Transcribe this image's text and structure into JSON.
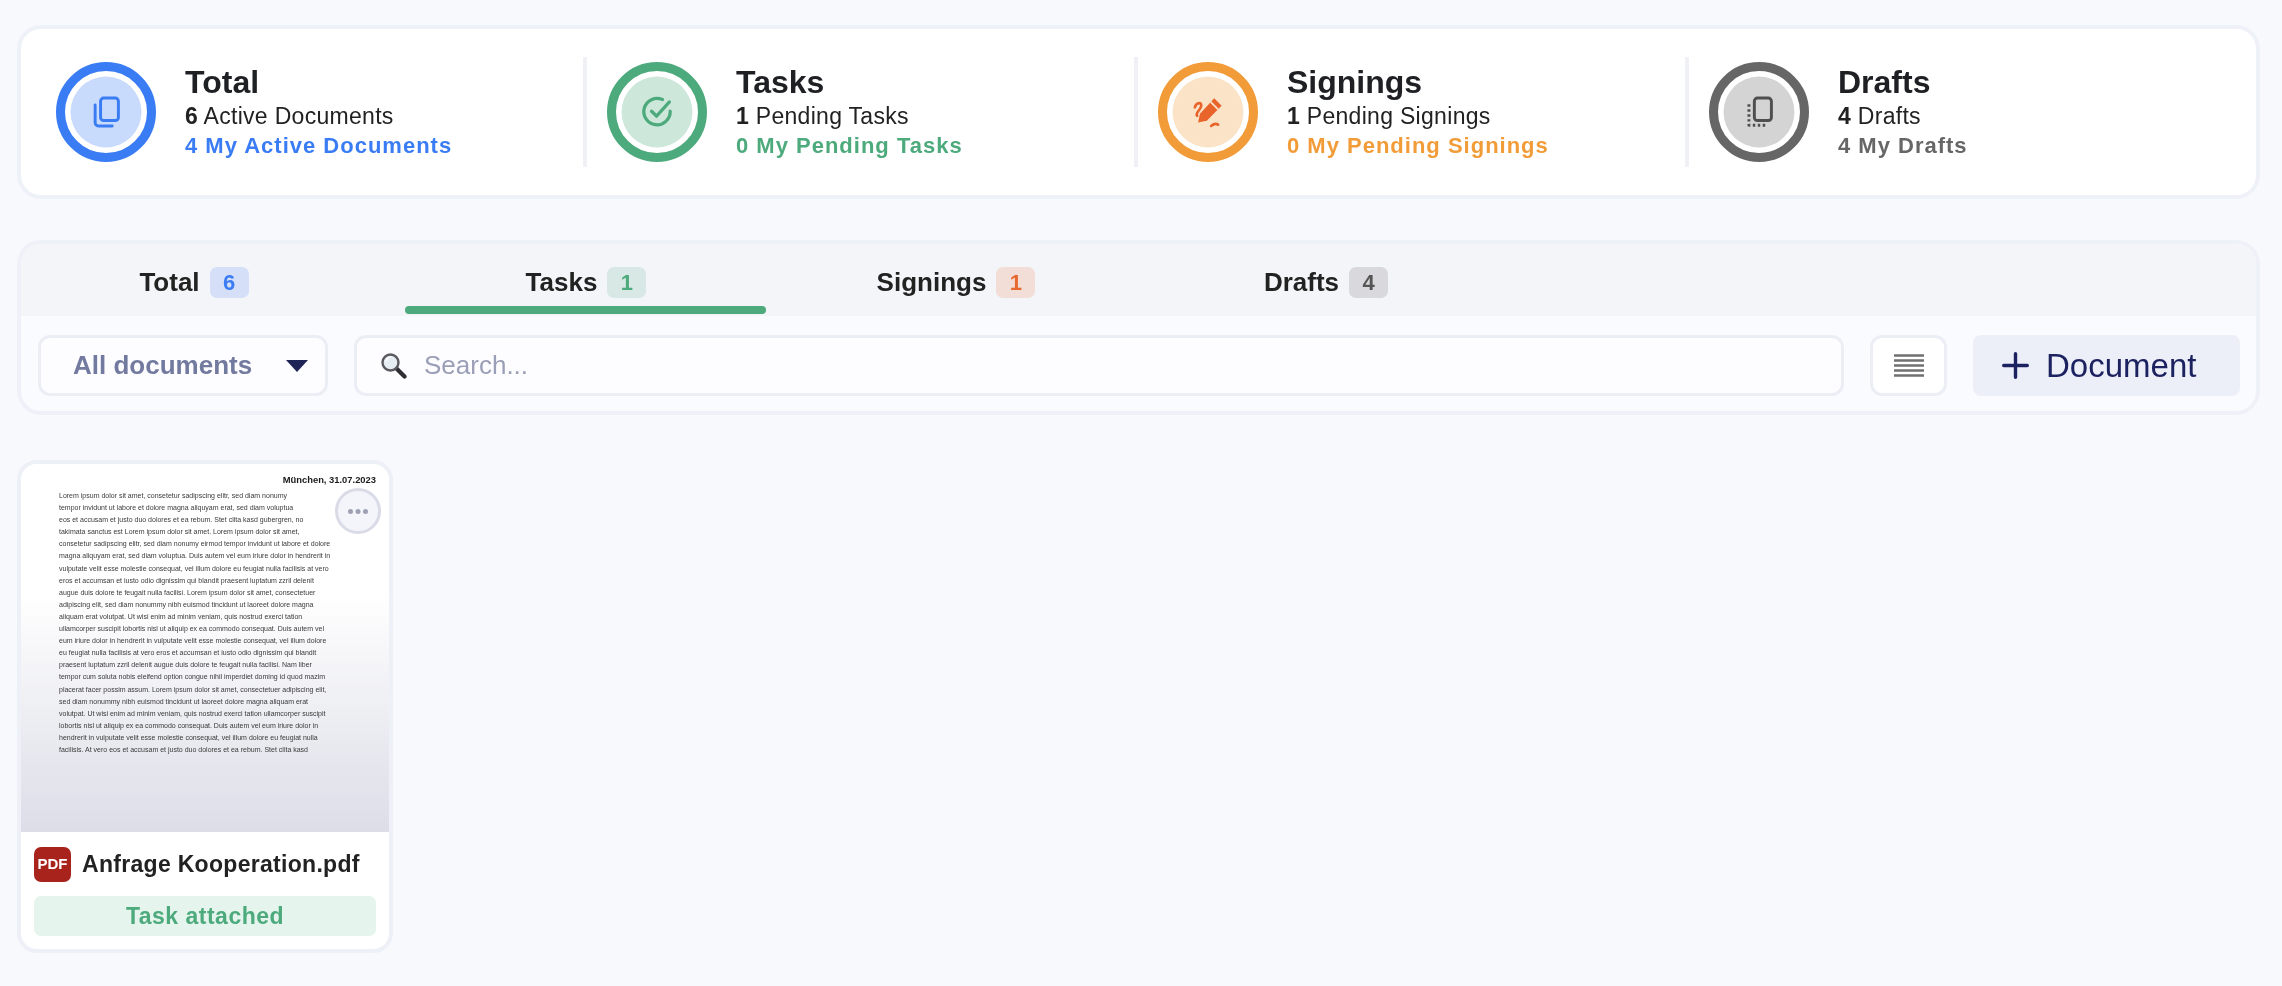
{
  "summary": [
    {
      "kind": "total",
      "title": "Total",
      "detail": "**6** Active Documents",
      "mine": "4 My Active Documents",
      "color": "#3a7cf4"
    },
    {
      "kind": "tasks",
      "title": "Tasks",
      "detail": "**1** Pending Tasks",
      "mine": "0 My Pending Tasks",
      "color": "#4daa7c"
    },
    {
      "kind": "signings",
      "title": "Signings",
      "detail": "**1** Pending Signings",
      "mine": "0 My Pending Signings",
      "color": "#f29c39"
    },
    {
      "kind": "drafts",
      "title": "Drafts",
      "detail": "**4** Drafts",
      "mine": "4 My Drafts",
      "color": "#666666"
    }
  ],
  "tabs": [
    {
      "label": "Total",
      "count": "6",
      "color": "#3a7cf4",
      "selected": false
    },
    {
      "label": "Tasks",
      "count": "1",
      "color": "#4daa7c",
      "selected": true
    },
    {
      "label": "Signings",
      "count": "1",
      "color": "#e8692f",
      "selected": false
    },
    {
      "label": "Drafts",
      "count": "4",
      "color": "#555555",
      "selected": false
    }
  ],
  "filter": {
    "value": "All documents"
  },
  "search": {
    "placeholder": "Search..."
  },
  "new_document_button": {
    "label": "Document"
  },
  "documents": [
    {
      "preview": {
        "date": "München, 31.07.2023",
        "lines": [
          "Lorem ipsum dolor sit amet, consetetur sadipscing elitr, sed diam nonumy",
          "tempor invidunt ut labore et dolore magna aliquyam erat, sed diam voluptua",
          "eos et accusam et justo duo dolores et ea rebum. Stet clita kasd gubergren, no",
          "takimata sanctus est Lorem ipsum dolor sit amet. Lorem ipsum dolor sit amet,",
          "consetetur sadipscing elitr, sed diam nonumy eirmod tempor invidunt ut labore et dolore",
          "magna aliquyam erat, sed diam voluptua. Duis autem vel eum iriure dolor in hendrerit in",
          "vulputate velit esse molestie consequat, vel illum dolore eu feugiat nulla facilisis at vero",
          "eros et accumsan et iusto odio dignissim qui blandit praesent luptatum zzril delenit",
          "augue duis dolore te feugait nulla facilisi. Lorem ipsum dolor sit amet, consectetuer",
          "adipiscing elit, sed diam nonummy nibh euismod tincidunt ut laoreet dolore magna",
          "aliquam erat volutpat. Ut wisi enim ad minim veniam, quis nostrud exerci tation",
          "ullamcorper suscipit lobortis nisl ut aliquip ex ea commodo consequat. Duis autem vel",
          "eum iriure dolor in hendrerit in vulputate velit esse molestie consequat, vel illum dolore",
          "eu feugiat nulla facilisis at vero eros et accumsan et iusto odio dignissim qui blandit",
          "praesent luptatum zzril delenit augue duis dolore te feugait nulla facilisi. Nam liber",
          "tempor cum soluta nobis eleifend option congue nihil imperdiet doming id quod mazim",
          "placerat facer possim assum. Lorem ipsum dolor sit amet, consectetuer adipiscing elit,",
          "sed diam nonummy nibh euismod tincidunt ut laoreet dolore magna aliquam erat",
          "volutpat. Ut wisi enim ad minim veniam, quis nostrud exerci tation ullamcorper suscipit",
          "lobortis nisl ut aliquip ex ea commodo consequat. Duis autem vel eum iriure dolor in",
          "hendrerit in vulputate velit esse molestie consequat, vel illum dolore eu feugiat nulla",
          "facilisis. At vero eos et accusam et justo duo dolores et ea rebum. Stet clita kasd"
        ]
      },
      "file_type": "PDF",
      "name": "Anfrage Kooperation.pdf",
      "status": "Task attached"
    }
  ]
}
